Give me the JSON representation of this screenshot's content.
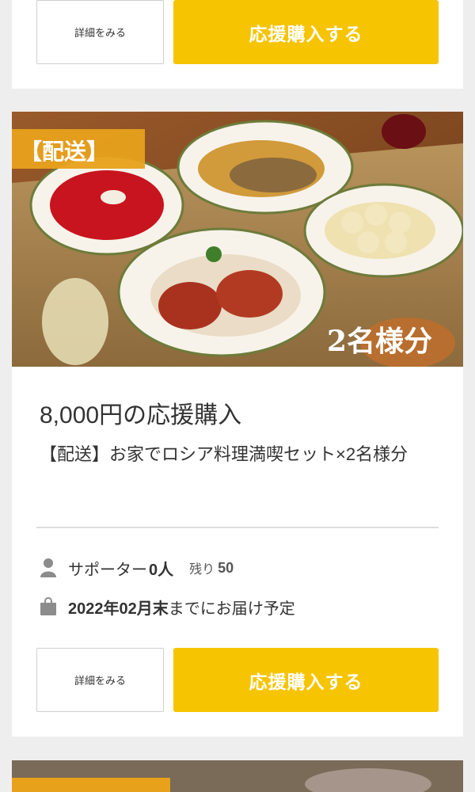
{
  "theme": {
    "accent": "#f6c400",
    "badge_bg": "#e8a11b",
    "page_bg": "#eeeeee"
  },
  "top_card": {
    "detail_label": "詳細をみる",
    "buy_label": "応援購入する"
  },
  "product": {
    "badge": "【配送】",
    "photo_overlay": "2名様分",
    "price_title": "8,000円の応援購入",
    "name": "【配送】お家でロシア料理満喫セット×2名様分",
    "supporters_label": "サポーター",
    "supporters_count": "0人",
    "remaining_label": "残り",
    "remaining_count": "50",
    "delivery_date": "2022年02月末",
    "delivery_suffix": "までにお届け予定",
    "detail_label": "詳細をみる",
    "buy_label": "応援購入する",
    "icons": {
      "supporter": "person-icon",
      "delivery": "shopping-bag-icon"
    }
  }
}
